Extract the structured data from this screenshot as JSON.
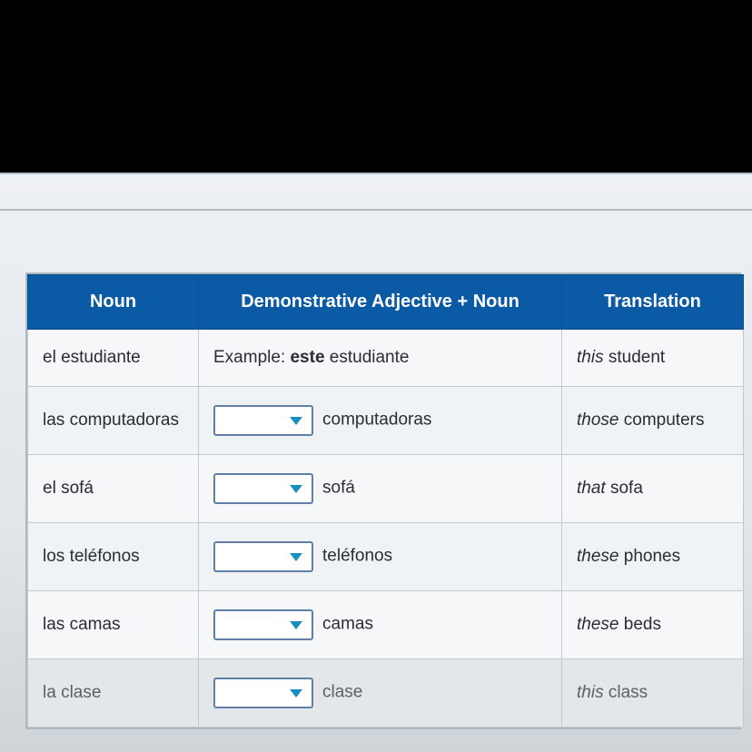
{
  "headers": {
    "noun": "Noun",
    "adj": "Demonstrative Adjective + Noun",
    "trans": "Translation"
  },
  "example": {
    "noun": "el estudiante",
    "prefix": "Example: ",
    "bold": "este",
    "suffix": " estudiante",
    "trans_i": "this",
    "trans_r": " student"
  },
  "rows": [
    {
      "noun": "las computadoras",
      "after": "computadoras",
      "ti": "those",
      "tr": " computers"
    },
    {
      "noun": "el sofá",
      "after": "sofá",
      "ti": "that",
      "tr": " sofa"
    },
    {
      "noun": "los teléfonos",
      "after": "teléfonos",
      "ti": "these",
      "tr": " phones"
    },
    {
      "noun": "las camas",
      "after": "camas",
      "ti": "these",
      "tr": " beds"
    },
    {
      "noun": "la clase",
      "after": "clase",
      "ti": "this",
      "tr": " class"
    }
  ]
}
